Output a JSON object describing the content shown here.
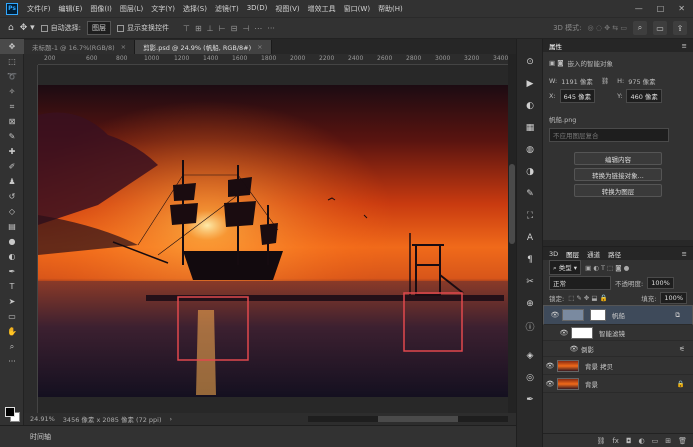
{
  "app": {
    "logo": "Ps"
  },
  "menu": [
    "文件(F)",
    "编辑(E)",
    "图像(I)",
    "图层(L)",
    "文字(Y)",
    "选择(S)",
    "滤镜(T)",
    "3D(D)",
    "视图(V)",
    "增效工具",
    "窗口(W)",
    "帮助(H)"
  ],
  "window_controls": [
    "—",
    "□",
    "✕"
  ],
  "options": {
    "auto_select_label": "自动选择:",
    "auto_select_value": "图层",
    "show_transform_label": "显示变换控件",
    "mode_3d": "3D 模式:",
    "more": "···"
  },
  "tabs": [
    {
      "label": "未标题-1 @ 16.7%(RGB/8)",
      "close": "×"
    },
    {
      "label": "剪影.psd @ 24.9% (帆船, RGB/8#)",
      "close": "×"
    }
  ],
  "ruler_ticks": [
    "200",
    "600",
    "800",
    "1000",
    "1200",
    "1400",
    "1600",
    "1800",
    "2000",
    "2200",
    "2400",
    "2600",
    "2800",
    "3000",
    "3200",
    "3400"
  ],
  "status": {
    "zoom": "24.91%",
    "doc_info": "3456 像素 x 2085 像素 (72 ppi)",
    "arrow": "›"
  },
  "timeline": {
    "label": "时间轴"
  },
  "properties": {
    "tab": "属性",
    "object_type": "嵌入的智能对象",
    "w_label": "W:",
    "w_value": "1191 像素",
    "h_label": "H:",
    "h_value": "975 像素",
    "x_label": "X:",
    "x_value": "645 像素",
    "y_label": "Y:",
    "y_value": "460 像素",
    "file_name": "帆船.png",
    "comp_placeholder": "不应用图层复合",
    "buttons": [
      "编辑内容",
      "转换为链接对象...",
      "转换为图层"
    ]
  },
  "layers_panel": {
    "tabs": [
      "3D",
      "图层",
      "通道",
      "路径"
    ],
    "filter_kind": "类型",
    "blend_mode": "正常",
    "opacity_label": "不透明度:",
    "opacity_value": "100%",
    "lock_label": "锁定:",
    "fill_label": "填充:",
    "fill_value": "100%",
    "layers": [
      {
        "name": "帆船",
        "selected": true
      },
      {
        "name": "智能滤镜",
        "selected": false
      },
      {
        "name": "倒影",
        "selected": false
      },
      {
        "name": "背景 拷贝",
        "selected": false
      },
      {
        "name": "背景",
        "selected": false
      }
    ],
    "footer_icons": [
      "link-icon",
      "fx-icon",
      "mask-icon",
      "adjustment-icon",
      "group-icon",
      "new-layer-icon",
      "trash-icon"
    ]
  },
  "colors": {
    "accent": "#31a8ff",
    "selection_box": "#e0484d",
    "sky_top": "#1c0b12",
    "sun": "#ff8a1a"
  }
}
